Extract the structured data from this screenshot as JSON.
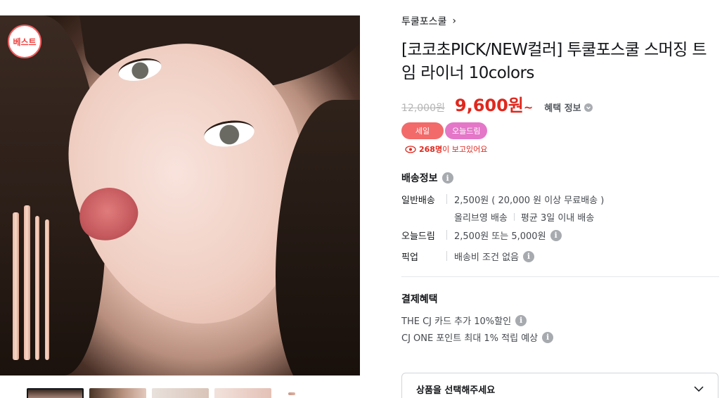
{
  "gallery": {
    "best_badge": "베스트",
    "main_image_alt": "",
    "thumbnail_count": 5
  },
  "product": {
    "brand": "투쿨포스쿨",
    "brand_chevron": "›",
    "title": "[코코초PICK/NEW컬러] 투쿨포스쿨 스머징 트임 라이너 10colors",
    "original_price": "12,000원",
    "sale_price": "9,600원",
    "sale_price_suffix": "~",
    "benefit_link": "혜택 정보"
  },
  "tags": {
    "sale": "세일",
    "today_dream": "오늘드림"
  },
  "viewing": {
    "count": "268명",
    "text": "이 보고있어요"
  },
  "shipping": {
    "title": "배송정보",
    "general_label": "일반배송",
    "general_value": "2,500원 ( 20,000 원 이상 무료배송 )",
    "general_sub_1": "올리브영 배송",
    "general_sub_2": "평균 3일 이내 배송",
    "today_label": "오늘드림",
    "today_value": "2,500원 또는 5,000원",
    "pickup_label": "픽업",
    "pickup_value": "배송비 조건 없음"
  },
  "payment": {
    "title": "결제혜택",
    "benefit_1": "THE CJ 카드 추가 10%할인",
    "benefit_2": "CJ ONE 포인트 최대 1% 적립 예상"
  },
  "option": {
    "placeholder": "상품을 선택해주세요"
  },
  "colors": {
    "sale_red": "#e0271d",
    "sale_tag": "#f26a6a",
    "today_tag": "#e477c8",
    "best_badge": "#f0413f"
  }
}
